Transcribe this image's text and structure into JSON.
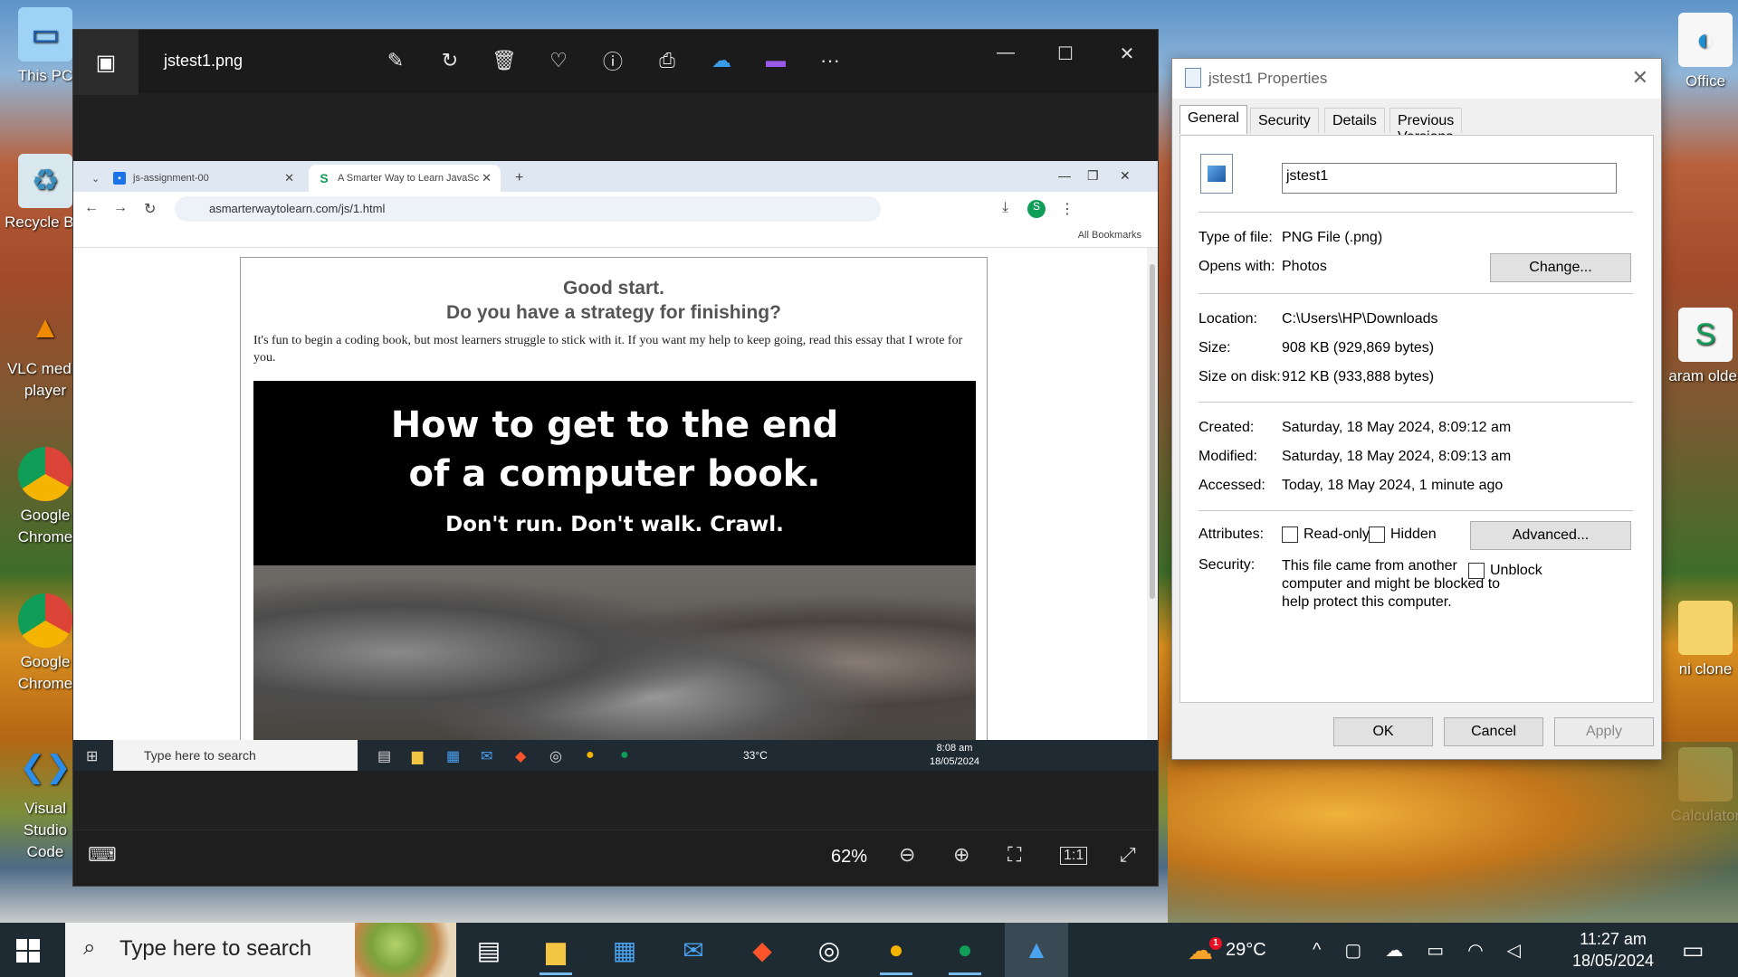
{
  "desktop": {
    "icons": [
      {
        "label": "This PC"
      },
      {
        "label": "Recycle Bin"
      },
      {
        "label": "VLC media player"
      },
      {
        "label": "Google Chrome"
      },
      {
        "label": "Google Chrome"
      },
      {
        "label": "Visual Studio Code"
      },
      {
        "label": "Office"
      },
      {
        "label": "aram older"
      },
      {
        "label": "ni clone"
      },
      {
        "label": "Calculator"
      }
    ]
  },
  "photos": {
    "file_name": "jstest1.png",
    "toolbar": [
      "edit-image-icon",
      "rotate-icon",
      "delete-icon",
      "favorite-icon",
      "info-icon",
      "print-icon",
      "onedrive-icon",
      "clipchamp-icon",
      "more-icon"
    ],
    "more_label": "···",
    "zoom": "62%",
    "minimize": "—",
    "maximize": "☐",
    "close": "✕"
  },
  "screenshot": {
    "tabs": [
      {
        "title": "js-assignment-00"
      },
      {
        "title": "A Smarter Way to Learn JavaSc"
      }
    ],
    "new_tab": "+",
    "url": "asmarterwaytolearn.com/js/1.html",
    "bookmarks": "All Bookmarks",
    "heading1": "Good start.",
    "heading2": "Do you have a strategy for finishing?",
    "paragraph": "It's fun to begin a coding book, but most learners struggle to stick with it. If you want my help to keep going, read this essay that I wrote for you.",
    "banner_line1": "How to get to the end",
    "banner_line2": "of a computer book.",
    "banner_line3": "Don't run. Don't walk. Crawl.",
    "mini_taskbar": {
      "search": "Type here to search",
      "temp": "33°C",
      "time": "8:08 am",
      "date": "18/05/2024"
    }
  },
  "properties": {
    "title": "jstest1 Properties",
    "tabs": [
      "General",
      "Security",
      "Details",
      "Previous Versions"
    ],
    "file_name": "jstest1",
    "type_label": "Type of file:",
    "type_value": "PNG File (.png)",
    "opens_label": "Opens with:",
    "opens_value": "Photos",
    "change_button": "Change...",
    "location_label": "Location:",
    "location_value": "C:\\Users\\HP\\Downloads",
    "size_label": "Size:",
    "size_value": "908 KB (929,869 bytes)",
    "size_disk_label": "Size on disk:",
    "size_disk_value": "912 KB (933,888 bytes)",
    "created_label": "Created:",
    "created_value": "Saturday, 18 May 2024, 8:09:12 am",
    "modified_label": "Modified:",
    "modified_value": "Saturday, 18 May 2024, 8:09:13 am",
    "accessed_label": "Accessed:",
    "accessed_value": "Today, 18 May 2024, 1 minute ago",
    "attributes_label": "Attributes:",
    "readonly_label": "Read-only",
    "hidden_label": "Hidden",
    "advanced_button": "Advanced...",
    "security_label": "Security:",
    "security_text": "This file came from another computer and might be blocked to help protect this computer.",
    "unblock_label": "Unblock",
    "ok_button": "OK",
    "cancel_button": "Cancel",
    "apply_button": "Apply"
  },
  "taskbar": {
    "search": "Type here to search",
    "temp": "29°C",
    "weather_badge": "1",
    "time": "11:27 am",
    "date": "18/05/2024"
  }
}
